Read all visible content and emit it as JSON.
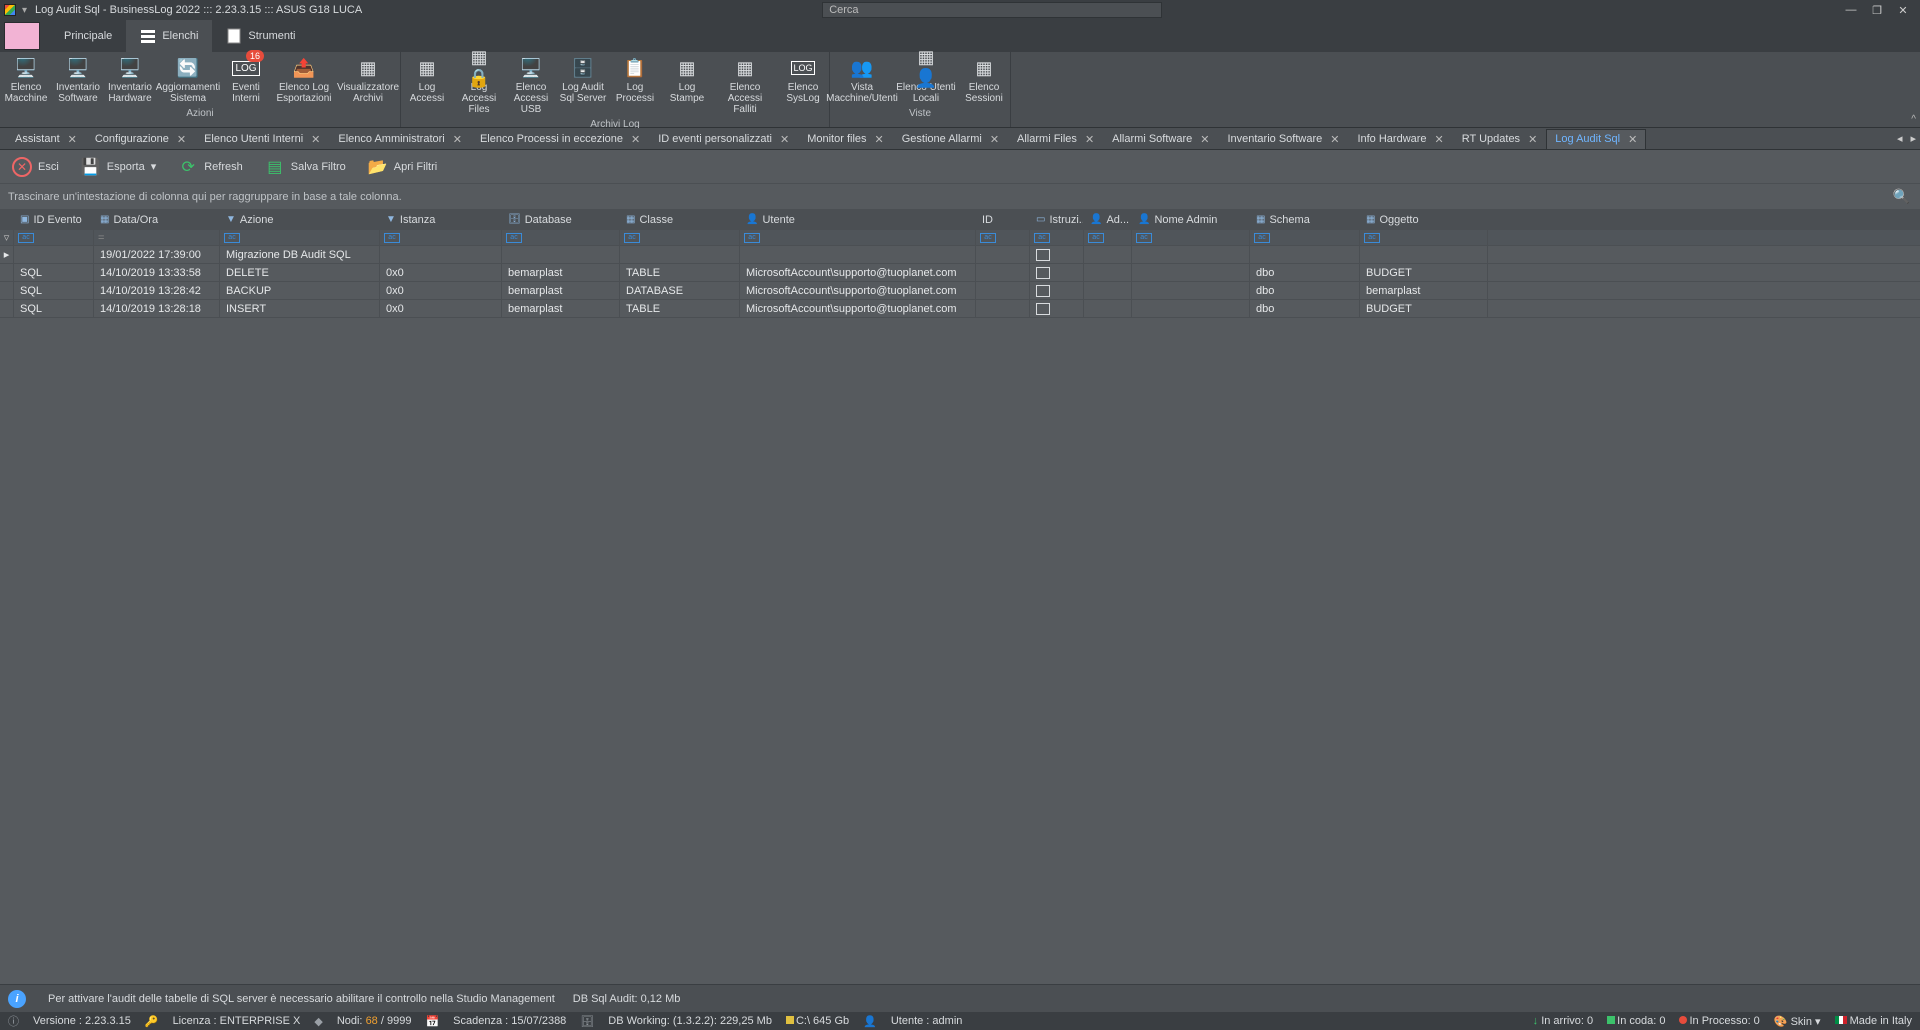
{
  "title": "Log Audit Sql - BusinessLog 2022 ::: 2.23.3.15 ::: ASUS G18 LUCA",
  "search_placeholder": "Cerca",
  "menu": {
    "principale": "Principale",
    "elenchi": "Elenchi",
    "strumenti": "Strumenti"
  },
  "ribbon": {
    "groups": {
      "azioni": "Azioni",
      "archivi": "Archivi Log",
      "viste": "Viste"
    },
    "btns": {
      "elenco_macchine": "Elenco Macchine",
      "inventario_software": "Inventario Software",
      "inventario_hardware": "Inventario Hardware",
      "aggiornamenti_sistema": "Aggiornamenti Sistema",
      "eventi_interni": "Eventi Interni",
      "elenco_log_esportazioni": "Elenco Log Esportazioni",
      "visualizzatore_archivi": "Visualizzatore Archivi",
      "log_accessi": "Log Accessi",
      "log_accessi_files": "Log Accessi Files",
      "elenco_accessi_usb": "Elenco Accessi USB",
      "log_audit_sql": "Log Audit Sql Server",
      "log_processi": "Log Processi",
      "log_stampe": "Log Stampe",
      "elenco_accessi_falliti": "Elenco Accessi Falliti",
      "elenco_syslog": "Elenco SysLog",
      "vista_macchine_utenti": "Vista Macchine/Utenti",
      "elenco_utenti_locali": "Elenco Utenti Locali",
      "elenco_sessioni": "Elenco Sessioni"
    },
    "badge_eventi": "16"
  },
  "tabs": [
    "Assistant",
    "Configurazione",
    "Elenco Utenti Interni",
    "Elenco Amministratori",
    "Elenco Processi in eccezione",
    "ID eventi personalizzati",
    "Monitor files",
    "Gestione Allarmi",
    "Allarmi Files",
    "Allarmi Software",
    "Inventario Software",
    "Info Hardware",
    "RT Updates",
    "Log Audit Sql"
  ],
  "toolbar": {
    "esci": "Esci",
    "esporta": "Esporta",
    "refresh": "Refresh",
    "salva_filtro": "Salva Filtro",
    "apri_filtri": "Apri Filtri"
  },
  "group_hint": "Trascinare un'intestazione di colonna qui per raggruppare in base a tale colonna.",
  "columns": {
    "id_evento": "ID Evento",
    "data_ora": "Data/Ora",
    "azione": "Azione",
    "istanza": "Istanza",
    "database": "Database",
    "classe": "Classe",
    "utente": "Utente",
    "id": "ID",
    "istruzioni": "Istruzi...",
    "admin": "Ad...",
    "nome_admin": "Nome Admin",
    "schema": "Schema",
    "oggetto": "Oggetto"
  },
  "rows": [
    {
      "id_evento": "",
      "data_ora": "19/01/2022 17:39:00",
      "azione": "Migrazione DB Audit SQL",
      "istanza": "",
      "database": "",
      "classe": "",
      "utente": "",
      "id": "",
      "istruzioni": true,
      "admin": "",
      "nome_admin": "",
      "schema": "",
      "oggetto": ""
    },
    {
      "id_evento": "SQL",
      "data_ora": "14/10/2019 13:33:58",
      "azione": "DELETE",
      "istanza": "0x0",
      "database": "bemarplast",
      "classe": "TABLE",
      "utente": "MicrosoftAccount\\supporto@tuoplanet.com",
      "id": "",
      "istruzioni": true,
      "admin": "",
      "nome_admin": "",
      "schema": "dbo",
      "oggetto": "BUDGET"
    },
    {
      "id_evento": "SQL",
      "data_ora": "14/10/2019 13:28:42",
      "azione": "BACKUP",
      "istanza": "0x0",
      "database": "bemarplast",
      "classe": "DATABASE",
      "utente": "MicrosoftAccount\\supporto@tuoplanet.com",
      "id": "",
      "istruzioni": true,
      "admin": "",
      "nome_admin": "",
      "schema": "dbo",
      "oggetto": "bemarplast"
    },
    {
      "id_evento": "SQL",
      "data_ora": "14/10/2019 13:28:18",
      "azione": "INSERT",
      "istanza": "0x0",
      "database": "bemarplast",
      "classe": "TABLE",
      "utente": "MicrosoftAccount\\supporto@tuoplanet.com",
      "id": "",
      "istruzioni": true,
      "admin": "",
      "nome_admin": "",
      "schema": "dbo",
      "oggetto": "BUDGET"
    }
  ],
  "info": {
    "msg": "Per attivare l'audit delle tabelle di SQL server è necessario abilitare il controllo nella Studio Management",
    "db": "DB Sql Audit: 0,12 Mb"
  },
  "status": {
    "versione": "Versione : 2.23.3.15",
    "licenza": "Licenza : ENTERPRISE X",
    "nodi_pre": "Nodi: ",
    "nodi_a": "68",
    "nodi_b": " / 9999",
    "scadenza": "Scadenza : 15/07/2388",
    "dbworking": "DB Working: (1.3.2.2): 229,25 Mb",
    "disk": "C:\\ 645 Gb",
    "utente": "Utente : admin",
    "arrivo": "In arrivo: 0",
    "coda": "In coda: 0",
    "processo": "In Processo: 0",
    "skin": "Skin",
    "made": "Made in Italy"
  }
}
